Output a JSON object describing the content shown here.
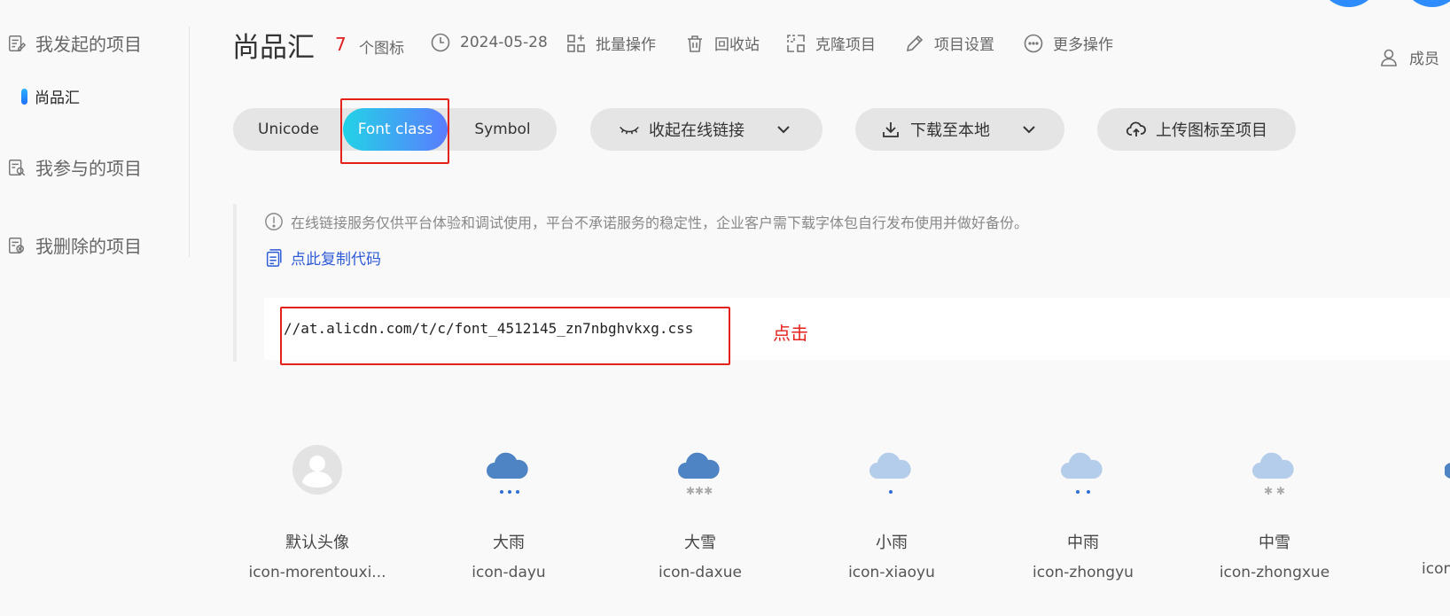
{
  "sidebar": {
    "items": [
      {
        "label": "我发起的项目",
        "icon": "edit-doc-icon"
      },
      {
        "label": "我参与的项目",
        "icon": "search-doc-icon"
      },
      {
        "label": "我删除的项目",
        "icon": "delete-doc-icon"
      }
    ],
    "active_project": "尚品汇"
  },
  "header": {
    "title": "尚品汇",
    "icon_count": "7",
    "icon_count_label": "个图标",
    "date": "2024-05-28",
    "actions": [
      {
        "label": "批量操作",
        "icon": "grid-icon"
      },
      {
        "label": "回收站",
        "icon": "trash-icon"
      },
      {
        "label": "克隆项目",
        "icon": "clone-icon"
      },
      {
        "label": "项目设置",
        "icon": "pencil-icon"
      },
      {
        "label": "更多操作",
        "icon": "more-icon"
      }
    ],
    "members_label": "成员"
  },
  "toolbar": {
    "tabs": [
      "Unicode",
      "Font class",
      "Symbol"
    ],
    "active_tab": "Font class",
    "collapse_link_label": "收起在线链接",
    "download_label": "下载至本地",
    "upload_label": "上传图标至项目"
  },
  "notice": {
    "text": "在线链接服务仅供平台体验和调试使用，平台不承诺服务的稳定性，企业客户需下载字体包自行发布使用并做好备份。",
    "copy_label": "点此复制代码"
  },
  "link": {
    "url": "//at.alicdn.com/t/c/font_4512145_zn7nbghvkxg.css",
    "annotation": "点击"
  },
  "icons": [
    {
      "name": "默认头像",
      "class": "icon-morentouxi...",
      "glyph": "avatar-icon"
    },
    {
      "name": "大雨",
      "class": "icon-dayu",
      "glyph": "heavy-rain-icon"
    },
    {
      "name": "大雪",
      "class": "icon-daxue",
      "glyph": "heavy-snow-icon"
    },
    {
      "name": "小雨",
      "class": "icon-xiaoyu",
      "glyph": "light-rain-icon"
    },
    {
      "name": "中雨",
      "class": "icon-zhongyu",
      "glyph": "moderate-rain-icon"
    },
    {
      "name": "中雪",
      "class": "icon-zhongxue",
      "glyph": "moderate-snow-icon"
    },
    {
      "name": "",
      "class": "icon",
      "glyph": "cloud-icon"
    }
  ],
  "colors": {
    "accent_gradient_start": "#22d3e6",
    "accent_gradient_end": "#5a7cff",
    "highlight_red": "#e5211b",
    "link_blue": "#2e5bd6",
    "dark_cloud": "#4f84c4",
    "light_cloud": "#b3cdea"
  }
}
